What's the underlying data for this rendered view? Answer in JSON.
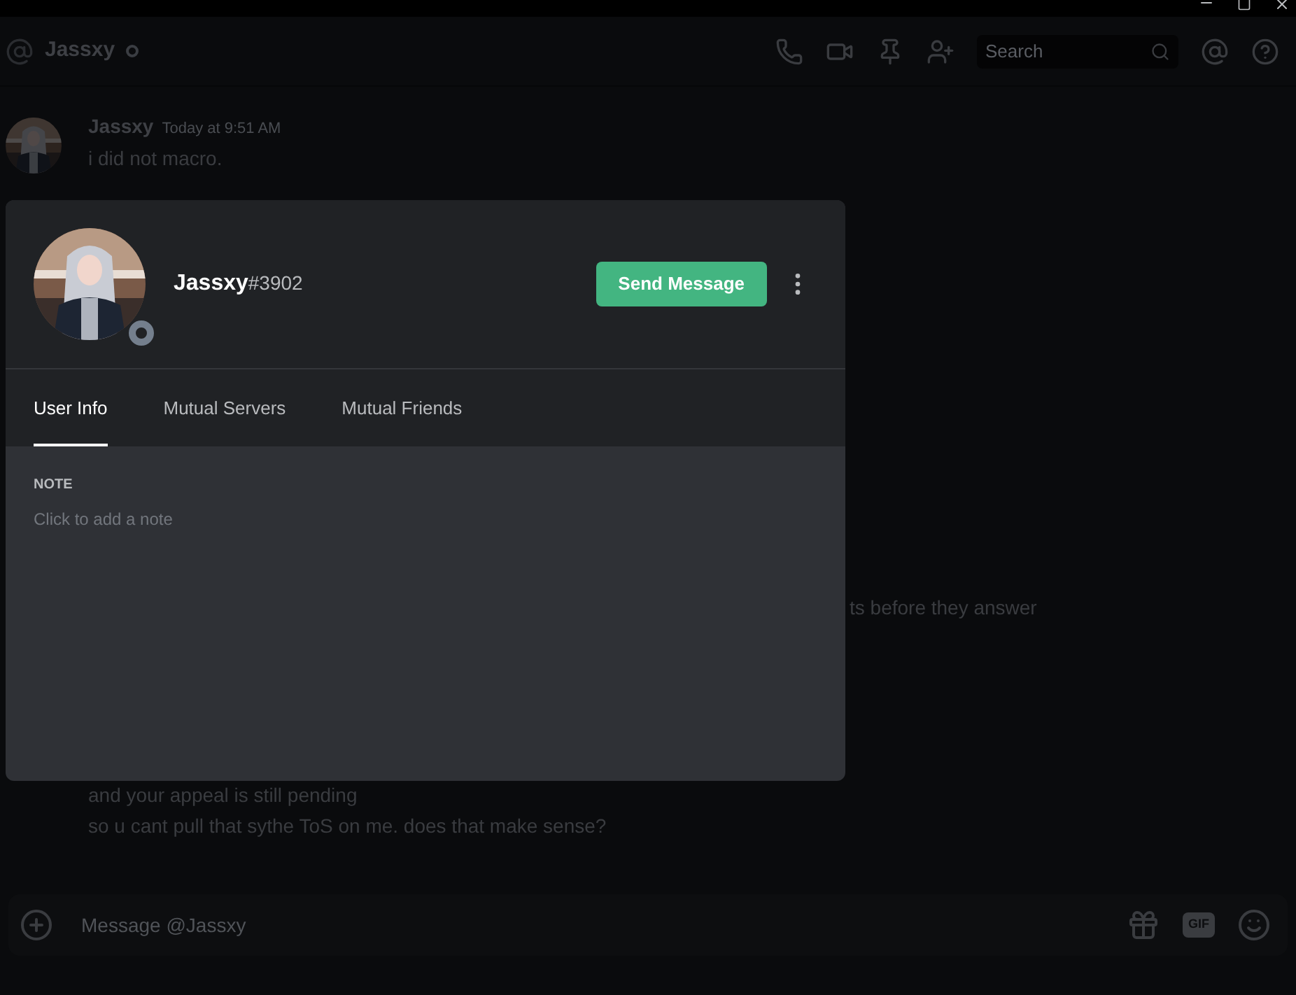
{
  "header": {
    "channel_name": "Jassxy",
    "search": {
      "placeholder": "Search"
    }
  },
  "messages": [
    {
      "kind": "group",
      "author": "Jassxy",
      "timestamp": "Today at 9:51 AM",
      "text": "i did not macro."
    },
    {
      "kind": "partial",
      "text": "ts before they answer"
    },
    {
      "kind": "line",
      "text": "and your appeal is still pending"
    },
    {
      "kind": "line",
      "text": "so u cant pull that sythe ToS on me. does that make sense?"
    }
  ],
  "composer": {
    "placeholder": "Message @Jassxy",
    "gif_label": "GIF"
  },
  "profile": {
    "username": "Jassxy",
    "discriminator": "#3902",
    "send_button": "Send Message",
    "tabs": [
      {
        "label": "User Info",
        "selected": true
      },
      {
        "label": "Mutual Servers",
        "selected": false
      },
      {
        "label": "Mutual Friends",
        "selected": false
      }
    ],
    "note": {
      "heading": "NOTE",
      "placeholder": "Click to add a note"
    }
  }
}
